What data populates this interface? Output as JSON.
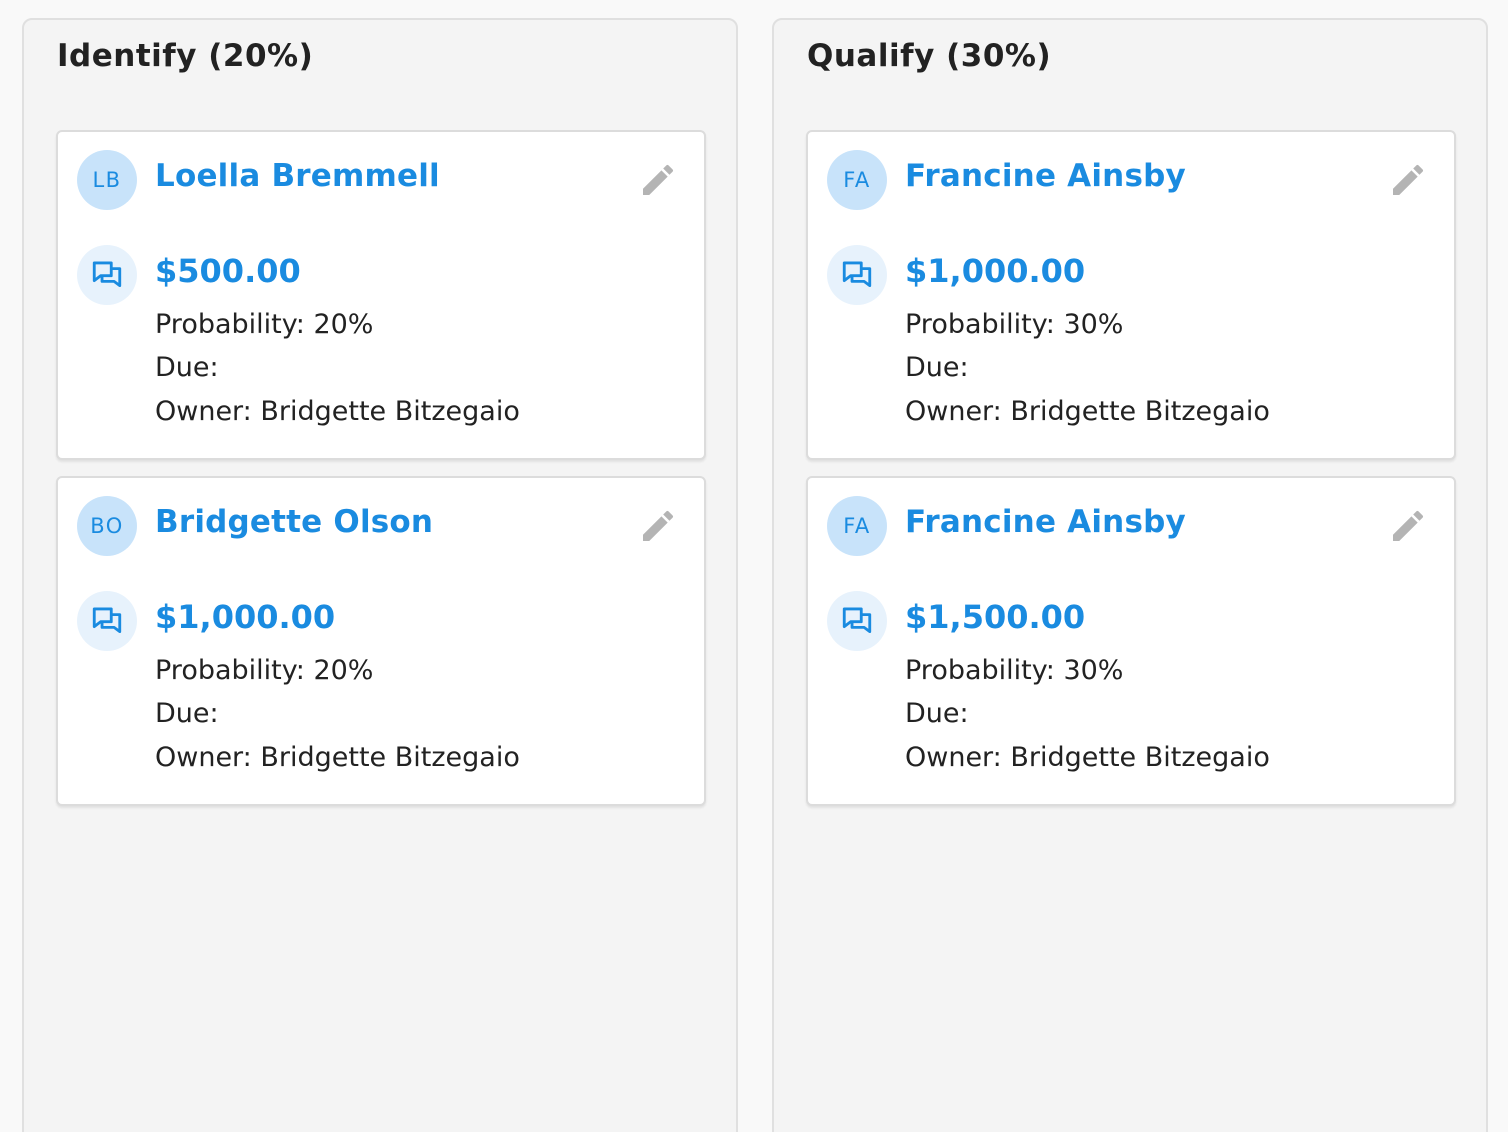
{
  "columns": [
    {
      "title": "Identify (20%)",
      "cards": [
        {
          "initials": "LB",
          "name": "Loella Bremmell",
          "amount": "$500.00",
          "probability": "Probability: 20%",
          "due": "Due:",
          "owner": "Owner: Bridgette Bitzegaio"
        },
        {
          "initials": "BO",
          "name": "Bridgette Olson",
          "amount": "$1,000.00",
          "probability": "Probability: 20%",
          "due": "Due:",
          "owner": "Owner: Bridgette Bitzegaio"
        }
      ]
    },
    {
      "title": "Qualify (30%)",
      "cards": [
        {
          "initials": "FA",
          "name": "Francine Ainsby",
          "amount": "$1,000.00",
          "probability": "Probability: 30%",
          "due": "Due:",
          "owner": "Owner: Bridgette Bitzegaio"
        },
        {
          "initials": "FA",
          "name": "Francine Ainsby",
          "amount": "$1,500.00",
          "probability": "Probability: 30%",
          "due": "Due:",
          "owner": "Owner: Bridgette Bitzegaio"
        }
      ]
    }
  ],
  "icons": {
    "edit": "pencil-icon",
    "opportunity": "chat-bubbles-icon"
  },
  "colors": {
    "accent": "#1a8be0",
    "avatar_bg": "#c8e3fa",
    "icon_bg": "#e7f2fc",
    "edit_icon": "#b4b4b4",
    "text": "#222222"
  }
}
